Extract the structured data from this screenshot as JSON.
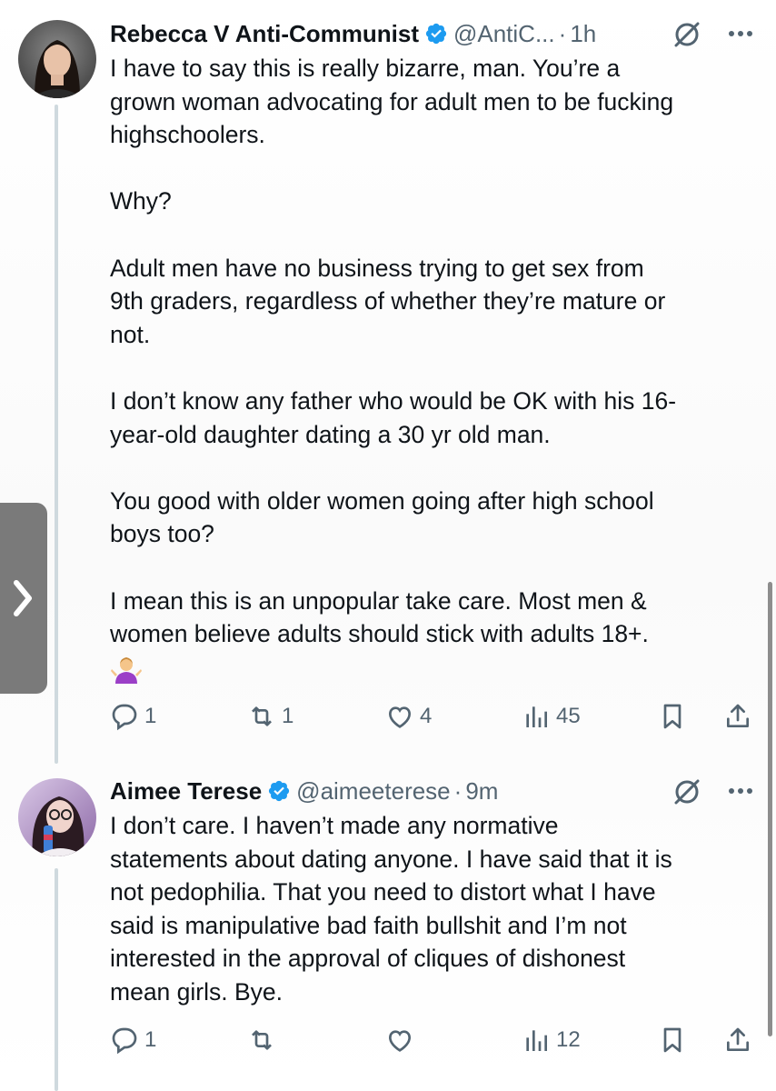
{
  "tweets": [
    {
      "display_name": "Rebecca V Anti-Communist",
      "handle": "@AntiC...",
      "time": "1h",
      "dot": "·",
      "text": "I have to say this is really bizarre, man. You’re a\ngrown woman advocating for adult men to be fucking\nhighschoolers.\n\nWhy?\n\nAdult men have no business trying to get sex from\n9th graders, regardless of whether they’re mature or\nnot.\n\nI don’t know any father who would be OK with his 16-\nyear-old daughter dating a 30 yr old man.\n\nYou good with older women going after high school\nboys too?\n\nI mean this is an unpopular take care. Most men &\nwomen believe adults should stick with adults 18+.",
      "emoji": "person-shrugging-emoji",
      "actions": {
        "replies": "1",
        "reposts": "1",
        "likes": "4",
        "views": "45"
      }
    },
    {
      "display_name": "Aimee Terese",
      "handle": "@aimeeterese",
      "time": "9m",
      "dot": "·",
      "text": "I don’t care. I haven’t made any normative\nstatements about dating anyone. I have said that it is\nnot pedophilia. That you need to distort what I have\nsaid is manipulative bad faith bullshit and I’m not\ninterested in the approval of cliques of dishonest\nmean girls. Bye.",
      "actions": {
        "replies": "1",
        "reposts": "",
        "likes": "",
        "views": "12"
      }
    }
  ],
  "icons": {
    "verified": "verified-badge-icon",
    "grok": "grok-slash-icon",
    "more": "more-dots-icon",
    "reply": "reply-icon",
    "repost": "repost-icon",
    "like": "heart-icon",
    "views": "views-bar-icon",
    "bookmark": "bookmark-icon",
    "share": "share-icon",
    "side_tab": "chevron-right-icon"
  },
  "colors": {
    "text": "#0f1419",
    "muted": "#536471",
    "verified_blue": "#1d9bf0",
    "thread_line": "#cfd9de",
    "side_tab": "#7a7a7a"
  }
}
